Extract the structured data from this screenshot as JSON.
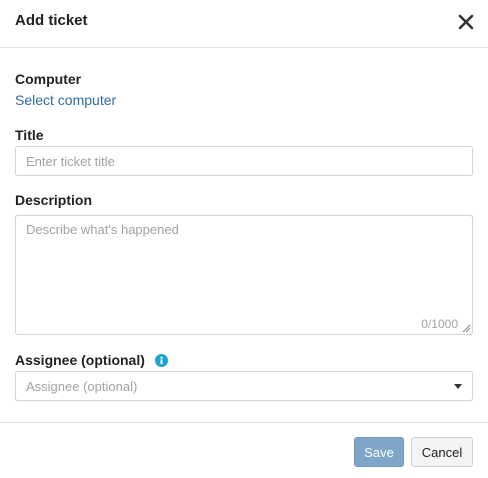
{
  "dialog": {
    "title": "Add ticket",
    "close_icon": "close-icon"
  },
  "computer": {
    "label": "Computer",
    "link_text": "Select computer"
  },
  "title_field": {
    "label": "Title",
    "placeholder": "Enter ticket title",
    "value": ""
  },
  "description": {
    "label": "Description",
    "placeholder": "Describe what's happened",
    "value": "",
    "counter": "0/1000"
  },
  "assignee": {
    "label": "Assignee (optional)",
    "info_icon": "info-icon",
    "placeholder": "Assignee (optional)"
  },
  "footer": {
    "save_label": "Save",
    "cancel_label": "Cancel"
  },
  "colors": {
    "link": "#2f6da3",
    "save_button": "#7fa6c9",
    "info_icon": "#1fa3c8"
  }
}
